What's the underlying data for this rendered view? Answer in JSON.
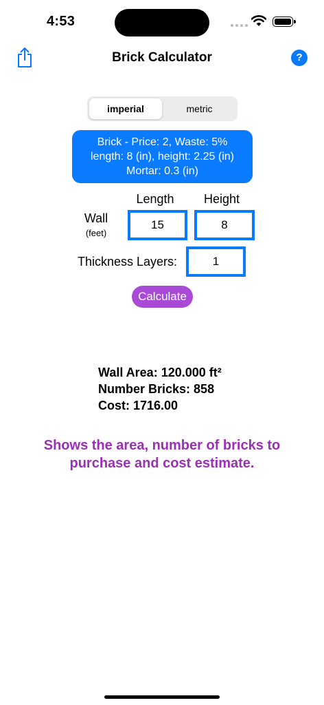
{
  "status": {
    "time": "4:53"
  },
  "nav": {
    "title": "Brick Calculator"
  },
  "segment": {
    "options": [
      "imperial",
      "metric"
    ],
    "selected": "imperial"
  },
  "info": {
    "line1": "Brick - Price: 2, Waste: 5%",
    "line2": "length: 8 (in), height: 2.25 (in)",
    "line3": "Mortar: 0.3 (in)"
  },
  "form": {
    "length_label": "Length",
    "height_label": "Height",
    "wall_label": "Wall",
    "wall_unit": "(feet)",
    "length_value": "15",
    "height_value": "8",
    "thickness_label": "Thickness Layers:",
    "thickness_value": "1",
    "calculate_label": "Calculate"
  },
  "results": {
    "area": "Wall Area: 120.000 ft²",
    "bricks": "Number Bricks: 858",
    "cost": "Cost: 1716.00"
  },
  "description": {
    "line1": "Shows the area, number of bricks to",
    "line2": "purchase and cost estimate."
  },
  "colors": {
    "accent": "#0a7aff",
    "button": "#a84ad6",
    "description": "#9b2fb6"
  },
  "icons": {
    "share": "share-icon",
    "help": "help-icon",
    "wifi": "wifi-icon",
    "battery": "battery-icon"
  }
}
